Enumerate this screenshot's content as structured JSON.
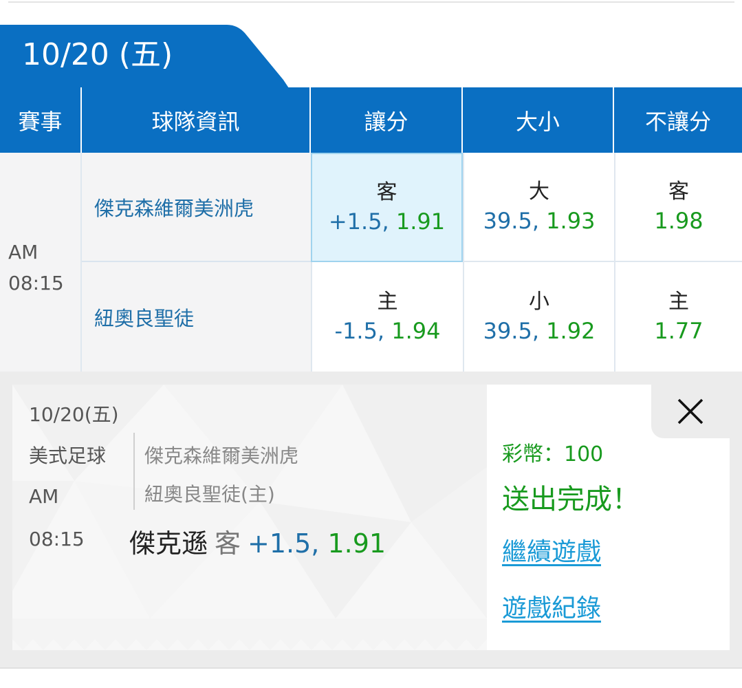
{
  "header": {
    "date": "10/20 (五)",
    "columns": [
      "賽事",
      "球隊資訊",
      "讓分",
      "大小",
      "不讓分"
    ]
  },
  "match": {
    "time_ampm": "AM",
    "time": "08:15",
    "rows": [
      {
        "team": "傑克森維爾美洲虎",
        "spread": {
          "label": "客",
          "handicap": "+1.5",
          "odds": "1.91",
          "selected": true
        },
        "total": {
          "label": "大",
          "line": "39.5",
          "odds": "1.93"
        },
        "moneyline": {
          "label": "客",
          "odds": "1.98"
        }
      },
      {
        "team": "紐奧良聖徒",
        "spread": {
          "label": "主",
          "handicap": "-1.5",
          "odds": "1.94"
        },
        "total": {
          "label": "小",
          "line": "39.5",
          "odds": "1.92"
        },
        "moneyline": {
          "label": "主",
          "odds": "1.77"
        }
      }
    ]
  },
  "slip": {
    "date": "10/20(五)",
    "sport": "美式足球",
    "time_ampm": "AM",
    "time": "08:15",
    "team1": "傑克森維爾美洲虎",
    "team2": "紐奧良聖徒(主)",
    "pick_team": "傑克遜",
    "pick_side": "客",
    "pick_handicap": "+1.5,",
    "pick_odds": "1.91",
    "coins": "彩幣：100",
    "status": "送出完成！",
    "continue_link": "繼續遊戲",
    "history_link": "遊戲紀錄"
  },
  "colors": {
    "brand_blue": "#0a6fc2",
    "odds_blue": "#1f6fa8",
    "odds_green": "#189a1e",
    "link_blue": "#1a9ad6",
    "selected_bg": "#e0f3fc"
  },
  "icons": {
    "close": "close-icon"
  }
}
